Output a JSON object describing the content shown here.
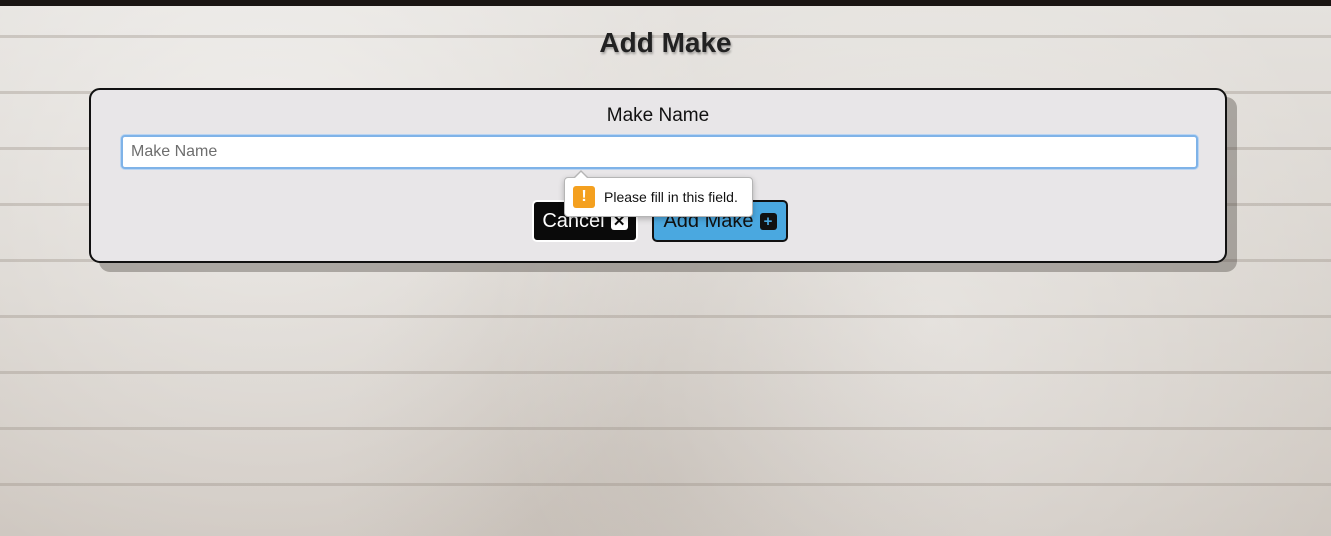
{
  "page": {
    "title": "Add Make"
  },
  "form": {
    "field_label": "Make Name",
    "input_placeholder": "Make Name",
    "input_value": ""
  },
  "buttons": {
    "cancel_label": "Cancel",
    "cancel_icon": "close-square-icon",
    "add_label": "Add Make",
    "add_icon": "plus-square-icon"
  },
  "validation_tooltip": {
    "message": "Please fill in this field.",
    "icon": "warning-icon"
  },
  "colors": {
    "add_button": "#4aa8e0",
    "cancel_button": "#0a0a0a",
    "warning": "#f4a01f"
  }
}
